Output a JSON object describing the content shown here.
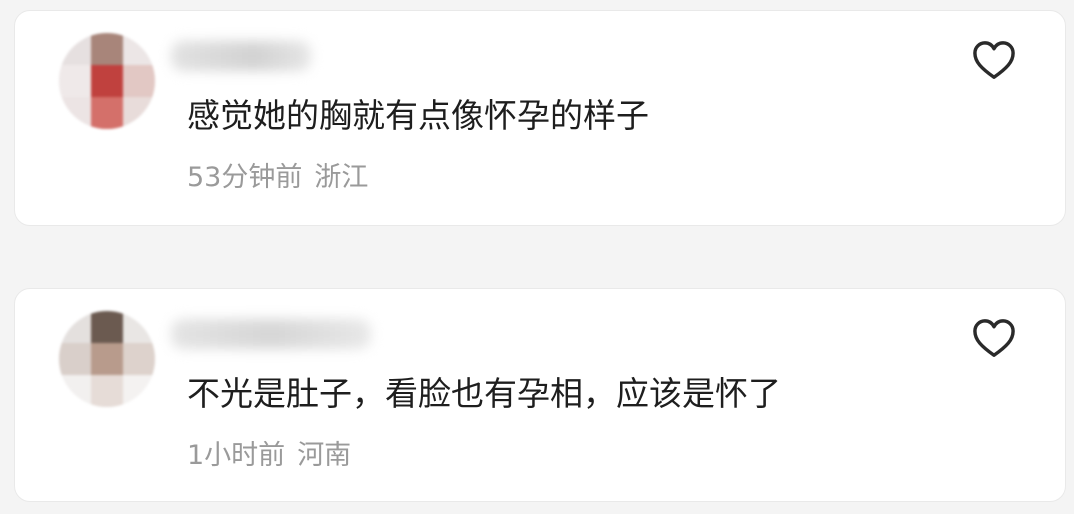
{
  "comments": [
    {
      "text": "感觉她的胸就有点像怀孕的样子",
      "time": "53分钟前",
      "location": "浙江"
    },
    {
      "text": "不光是肚子，看脸也有孕相，应该是怀了",
      "time": "1小时前",
      "location": "河南"
    }
  ],
  "icons": {
    "like": "heart-outline-icon"
  },
  "colors": {
    "comment_text": "#1e1e1e",
    "meta_text": "#9a9a9a",
    "card_background": "#ffffff",
    "page_background": "#f4f4f4"
  }
}
